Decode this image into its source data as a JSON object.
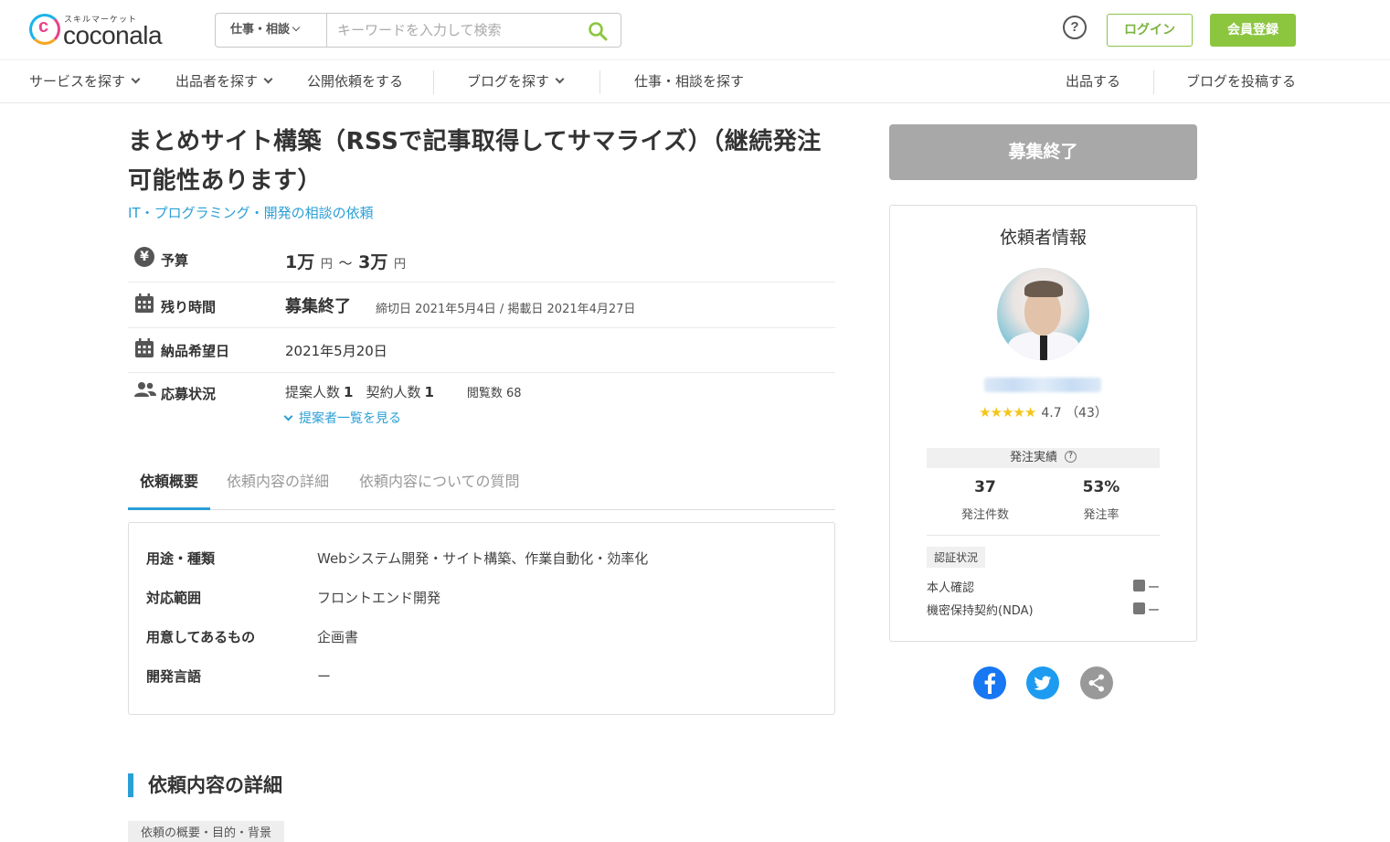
{
  "header": {
    "logo_kana": "スキルマーケット",
    "logo_text": "coconala",
    "search_category": "仕事・相談",
    "search_placeholder": "キーワードを入力して検索",
    "help": "?",
    "login": "ログイン",
    "register": "会員登録"
  },
  "nav": {
    "items": [
      "サービスを探す",
      "出品者を探す",
      "公開依頼をする",
      "ブログを探す",
      "仕事・相談を探す"
    ],
    "right": [
      "出品する",
      "ブログを投稿する"
    ]
  },
  "request": {
    "title": "まとめサイト構築（RSSで記事取得してサマライズ）（継続発注可能性あります）",
    "category": "IT・プログラミング・開発の相談の依頼",
    "budget": {
      "label": "予算",
      "min": "1万",
      "max": "3万",
      "unit": "円",
      "sep": "～",
      "icon": "¥"
    },
    "remaining": {
      "label": "残り時間",
      "status": "募集終了",
      "dates": "締切日 2021年5月4日 / 掲載日 2021年4月27日"
    },
    "delivery": {
      "label": "納品希望日",
      "value": "2021年5月20日"
    },
    "applications": {
      "label": "応募状況",
      "proposals_label": "提案人数",
      "proposals": "1",
      "contracts_label": "契約人数",
      "contracts": "1",
      "views": "閲覧数 68",
      "list_link": "提案者一覧を見る"
    }
  },
  "tabs": [
    "依頼概要",
    "依頼内容の詳細",
    "依頼内容についての質問"
  ],
  "summary": [
    {
      "label": "用途・種類",
      "value": "Webシステム開発・サイト構築、作業自動化・効率化"
    },
    {
      "label": "対応範囲",
      "value": "フロントエンド開発"
    },
    {
      "label": "用意してあるもの",
      "value": "企画書"
    },
    {
      "label": "開発言語",
      "value": "ー"
    }
  ],
  "detail_section": {
    "heading": "依頼内容の詳細",
    "subtag": "依頼の概要・目的・背景"
  },
  "sidebar": {
    "closed_button": "募集終了",
    "client": {
      "title": "依頼者情報",
      "stars": "★★★★★",
      "rating": "4.7",
      "reviews": "（43）",
      "perf_head": "発注実績",
      "orders": "37",
      "orders_label": "発注件数",
      "rate": "53%",
      "rate_label": "発注率",
      "verify_tag": "認証状況",
      "identity": "本人確認",
      "identity_status": "ー",
      "nda": "機密保持契約(NDA)",
      "nda_status": "ー"
    }
  },
  "colors": {
    "brand_blue": "#2a9fd6",
    "login_green": "#7cb342",
    "register_green": "#8cc63f",
    "closed_gray": "#a8a8a8",
    "facebook": "#1877f2",
    "twitter": "#1d9bf0"
  },
  "icons": [
    "search-icon",
    "help-icon",
    "yen-icon",
    "calendar-icon",
    "users-icon",
    "question-icon",
    "id-card-icon",
    "lock-icon",
    "facebook-icon",
    "twitter-icon",
    "share-icon"
  ]
}
